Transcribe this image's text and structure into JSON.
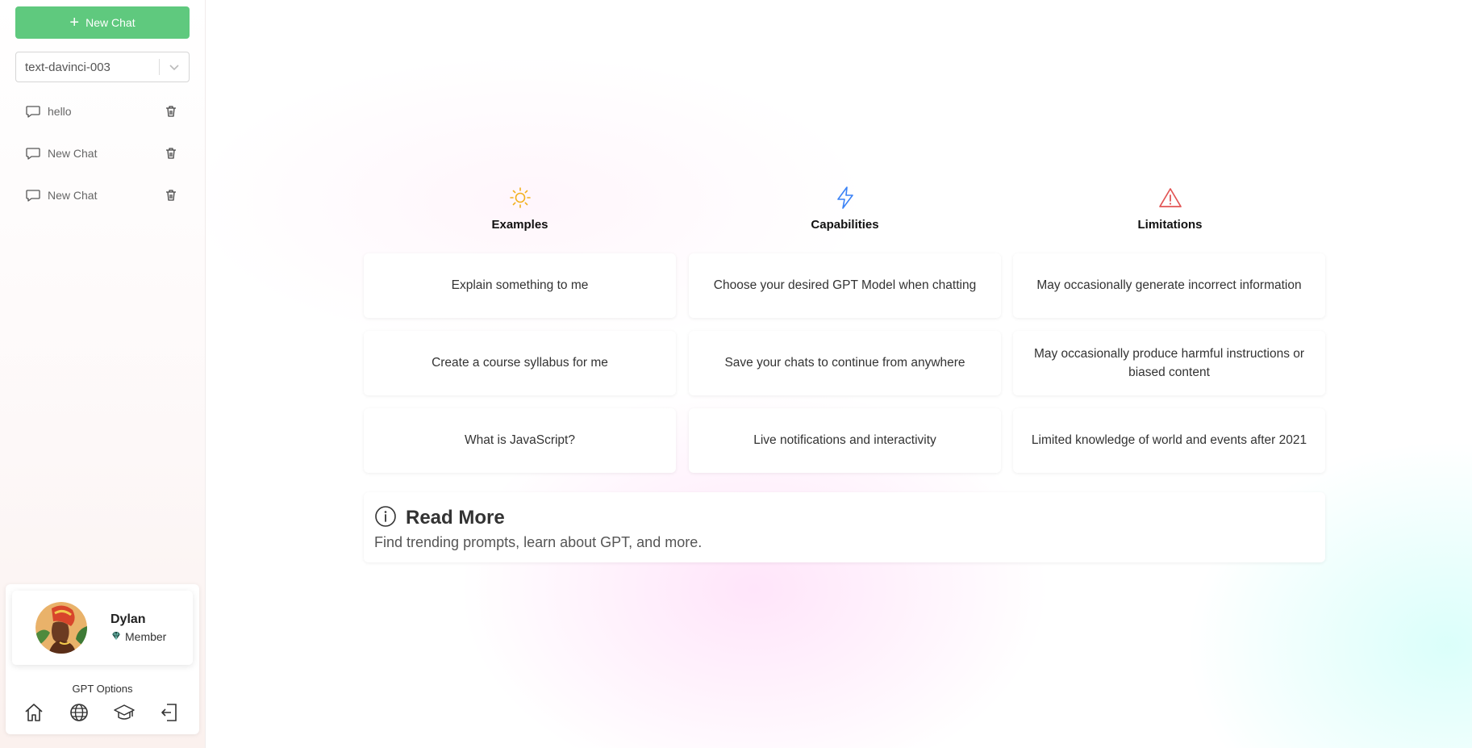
{
  "sidebar": {
    "new_chat_label": "New Chat",
    "model_select": {
      "value": "text-davinci-003"
    },
    "chats": [
      {
        "label": "hello"
      },
      {
        "label": "New Chat"
      },
      {
        "label": "New Chat"
      }
    ],
    "user": {
      "name": "Dylan",
      "role": "Member"
    },
    "gpt_options_title": "GPT Options",
    "option_icons": [
      "home-icon",
      "globe-icon",
      "graduation-cap-icon",
      "logout-icon"
    ]
  },
  "main": {
    "columns": [
      {
        "title": "Examples",
        "icon": "sun-icon",
        "icon_color": "#f2b01e",
        "items": [
          "Explain something to me",
          "Create a course syllabus for me",
          "What is JavaScript?"
        ]
      },
      {
        "title": "Capabilities",
        "icon": "lightning-icon",
        "icon_color": "#3b82f6",
        "items": [
          "Choose your desired GPT Model when chatting",
          "Save your chats to continue from anywhere",
          "Live notifications and interactivity"
        ]
      },
      {
        "title": "Limitations",
        "icon": "warning-icon",
        "icon_color": "#e25555",
        "items": [
          "May occasionally generate incorrect information",
          "May occasionally produce harmful instructions or biased content",
          "Limited knowledge of world and events after 2021"
        ]
      }
    ],
    "read_more": {
      "title": "Read More",
      "subtitle": "Find trending prompts, learn about GPT, and more."
    }
  },
  "colors": {
    "accent_green": "#5fc97e"
  }
}
